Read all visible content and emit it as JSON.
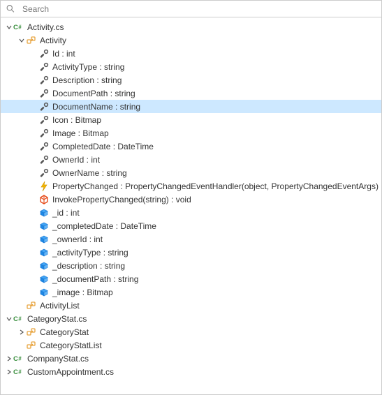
{
  "search": {
    "placeholder": "Search"
  },
  "icons": {
    "cs": "C#",
    "class": "class",
    "property": "wrench",
    "event": "lightning",
    "method": "cube",
    "field": "block"
  },
  "tree": [
    {
      "depth": 0,
      "caret": "down",
      "icon": "cs",
      "label": "Activity.cs",
      "selected": false
    },
    {
      "depth": 1,
      "caret": "down",
      "icon": "class",
      "label": "Activity",
      "selected": false
    },
    {
      "depth": 2,
      "caret": "none",
      "icon": "property",
      "label": "Id : int",
      "selected": false
    },
    {
      "depth": 2,
      "caret": "none",
      "icon": "property",
      "label": "ActivityType : string",
      "selected": false
    },
    {
      "depth": 2,
      "caret": "none",
      "icon": "property",
      "label": "Description : string",
      "selected": false
    },
    {
      "depth": 2,
      "caret": "none",
      "icon": "property",
      "label": "DocumentPath : string",
      "selected": false
    },
    {
      "depth": 2,
      "caret": "none",
      "icon": "property",
      "label": "DocumentName : string",
      "selected": true
    },
    {
      "depth": 2,
      "caret": "none",
      "icon": "property",
      "label": "Icon : Bitmap",
      "selected": false
    },
    {
      "depth": 2,
      "caret": "none",
      "icon": "property",
      "label": "Image : Bitmap",
      "selected": false
    },
    {
      "depth": 2,
      "caret": "none",
      "icon": "property",
      "label": "CompletedDate : DateTime",
      "selected": false
    },
    {
      "depth": 2,
      "caret": "none",
      "icon": "property",
      "label": "OwnerId : int",
      "selected": false
    },
    {
      "depth": 2,
      "caret": "none",
      "icon": "property",
      "label": "OwnerName : string",
      "selected": false
    },
    {
      "depth": 2,
      "caret": "none",
      "icon": "event",
      "label": "PropertyChanged : PropertyChangedEventHandler(object, PropertyChangedEventArgs)",
      "selected": false
    },
    {
      "depth": 2,
      "caret": "none",
      "icon": "method",
      "label": "InvokePropertyChanged(string) : void",
      "selected": false
    },
    {
      "depth": 2,
      "caret": "none",
      "icon": "field",
      "label": "_id : int",
      "selected": false
    },
    {
      "depth": 2,
      "caret": "none",
      "icon": "field",
      "label": "_completedDate : DateTime",
      "selected": false
    },
    {
      "depth": 2,
      "caret": "none",
      "icon": "field",
      "label": "_ownerId : int",
      "selected": false
    },
    {
      "depth": 2,
      "caret": "none",
      "icon": "field",
      "label": "_activityType : string",
      "selected": false
    },
    {
      "depth": 2,
      "caret": "none",
      "icon": "field",
      "label": "_description : string",
      "selected": false
    },
    {
      "depth": 2,
      "caret": "none",
      "icon": "field",
      "label": "_documentPath : string",
      "selected": false
    },
    {
      "depth": 2,
      "caret": "none",
      "icon": "field",
      "label": "_image : Bitmap",
      "selected": false
    },
    {
      "depth": 1,
      "caret": "none",
      "icon": "class",
      "label": "ActivityList",
      "selected": false
    },
    {
      "depth": 0,
      "caret": "down",
      "icon": "cs",
      "label": "CategoryStat.cs",
      "selected": false
    },
    {
      "depth": 1,
      "caret": "right",
      "icon": "class",
      "label": "CategoryStat",
      "selected": false
    },
    {
      "depth": 1,
      "caret": "none",
      "icon": "class",
      "label": "CategoryStatList",
      "selected": false
    },
    {
      "depth": 0,
      "caret": "right",
      "icon": "cs",
      "label": "CompanyStat.cs",
      "selected": false
    },
    {
      "depth": 0,
      "caret": "right",
      "icon": "cs",
      "label": "CustomAppointment.cs",
      "selected": false
    }
  ]
}
